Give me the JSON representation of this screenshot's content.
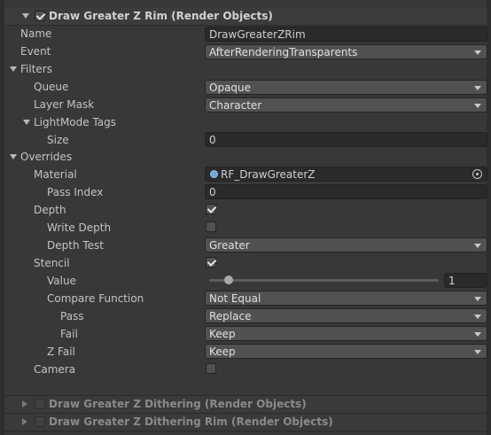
{
  "feature": {
    "title": "Draw Greater Z Rim (Render Objects)",
    "enabled": true,
    "name_label": "Name",
    "name_value": "DrawGreaterZRim",
    "event_label": "Event",
    "event_value": "AfterRenderingTransparents",
    "filters": {
      "label": "Filters",
      "queue_label": "Queue",
      "queue_value": "Opaque",
      "layer_mask_label": "Layer Mask",
      "layer_mask_value": "Character",
      "lightmode_label": "LightMode Tags",
      "size_label": "Size",
      "size_value": "0"
    },
    "overrides": {
      "label": "Overrides",
      "material_label": "Material",
      "material_value": "RF_DrawGreaterZ",
      "pass_index_label": "Pass Index",
      "pass_index_value": "0",
      "depth_label": "Depth",
      "depth_checked": true,
      "write_depth_label": "Write Depth",
      "write_depth_checked": false,
      "depth_test_label": "Depth Test",
      "depth_test_value": "Greater",
      "stencil_label": "Stencil",
      "stencil_checked": true,
      "value_label": "Value",
      "value_value": "1",
      "value_slider_fraction": 0.07,
      "compare_label": "Compare Function",
      "compare_value": "Not Equal",
      "pass_label": "Pass",
      "pass_value": "Replace",
      "fail_label": "Fail",
      "fail_value": "Keep",
      "zfail_label": "Z Fail",
      "zfail_value": "Keep",
      "camera_label": "Camera",
      "camera_checked": false
    }
  },
  "collapsed_features": [
    {
      "title": "Draw Greater Z Dithering (Render Objects)",
      "enabled": false
    },
    {
      "title": "Draw Greater Z Dithering Rim (Render Objects)",
      "enabled": false
    }
  ]
}
